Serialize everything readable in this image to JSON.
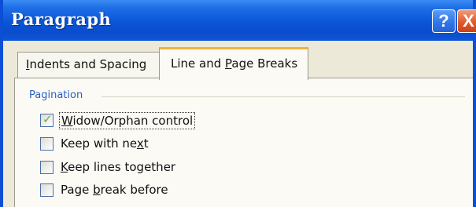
{
  "window": {
    "title": "Paragraph",
    "help_button": "?",
    "close_button": "X"
  },
  "tabs": [
    {
      "label_pre": "",
      "label_u": "I",
      "label_post": "ndents and Spacing",
      "selected": false
    },
    {
      "label_pre": "Line and ",
      "label_u": "P",
      "label_post": "age Breaks",
      "selected": true
    }
  ],
  "pagination": {
    "label": "Pagination",
    "options": [
      {
        "pre": "",
        "u": "W",
        "post": "idow/Orphan control",
        "checked": true
      },
      {
        "pre": "Keep with ne",
        "u": "x",
        "post": "t",
        "checked": false
      },
      {
        "pre": "",
        "u": "K",
        "post": "eep lines together",
        "checked": false
      },
      {
        "pre": "Page ",
        "u": "b",
        "post": "reak before",
        "checked": false
      }
    ]
  }
}
